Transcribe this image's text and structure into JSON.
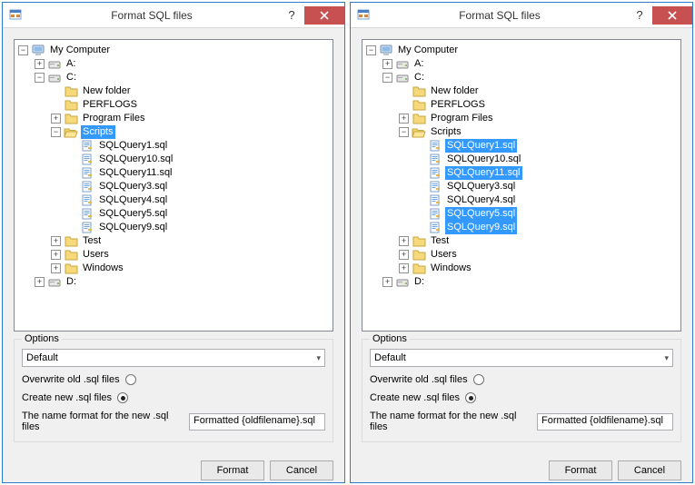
{
  "dialogs": [
    {
      "title": "Format SQL files",
      "tree": [
        {
          "depth": 0,
          "exp": "minus",
          "icon": "computer",
          "label": "My Computer",
          "sel": false
        },
        {
          "depth": 1,
          "exp": "plus",
          "icon": "drive",
          "label": "A:",
          "sel": false
        },
        {
          "depth": 1,
          "exp": "minus",
          "icon": "drive",
          "label": "C:",
          "sel": false
        },
        {
          "depth": 2,
          "exp": "none",
          "icon": "folder",
          "label": "New folder",
          "sel": false
        },
        {
          "depth": 2,
          "exp": "none",
          "icon": "folder",
          "label": "PERFLOGS",
          "sel": false
        },
        {
          "depth": 2,
          "exp": "plus",
          "icon": "folder",
          "label": "Program Files",
          "sel": false
        },
        {
          "depth": 2,
          "exp": "minus",
          "icon": "folder-open",
          "label": "Scripts",
          "sel": true
        },
        {
          "depth": 3,
          "exp": "none",
          "icon": "sql",
          "label": "SQLQuery1.sql",
          "sel": false
        },
        {
          "depth": 3,
          "exp": "none",
          "icon": "sql",
          "label": "SQLQuery10.sql",
          "sel": false
        },
        {
          "depth": 3,
          "exp": "none",
          "icon": "sql",
          "label": "SQLQuery11.sql",
          "sel": false
        },
        {
          "depth": 3,
          "exp": "none",
          "icon": "sql",
          "label": "SQLQuery3.sql",
          "sel": false
        },
        {
          "depth": 3,
          "exp": "none",
          "icon": "sql",
          "label": "SQLQuery4.sql",
          "sel": false
        },
        {
          "depth": 3,
          "exp": "none",
          "icon": "sql",
          "label": "SQLQuery5.sql",
          "sel": false
        },
        {
          "depth": 3,
          "exp": "none",
          "icon": "sql",
          "label": "SQLQuery9.sql",
          "sel": false
        },
        {
          "depth": 2,
          "exp": "plus",
          "icon": "folder",
          "label": "Test",
          "sel": false
        },
        {
          "depth": 2,
          "exp": "plus",
          "icon": "folder",
          "label": "Users",
          "sel": false
        },
        {
          "depth": 2,
          "exp": "plus",
          "icon": "folder",
          "label": "Windows",
          "sel": false
        },
        {
          "depth": 1,
          "exp": "plus",
          "icon": "drive",
          "label": "D:",
          "sel": false
        }
      ],
      "options_label": "Options",
      "combo_value": "Default",
      "overwrite_label": "Overwrite old .sql files",
      "overwrite_checked": false,
      "create_label": "Create new .sql files",
      "create_checked": true,
      "name_format_label": "The name format for the new .sql files",
      "name_format_value": "Formatted {oldfilename}.sql",
      "format_btn": "Format",
      "cancel_btn": "Cancel"
    },
    {
      "title": "Format SQL files",
      "tree": [
        {
          "depth": 0,
          "exp": "minus",
          "icon": "computer",
          "label": "My Computer",
          "sel": false
        },
        {
          "depth": 1,
          "exp": "plus",
          "icon": "drive",
          "label": "A:",
          "sel": false
        },
        {
          "depth": 1,
          "exp": "minus",
          "icon": "drive",
          "label": "C:",
          "sel": false
        },
        {
          "depth": 2,
          "exp": "none",
          "icon": "folder",
          "label": "New folder",
          "sel": false
        },
        {
          "depth": 2,
          "exp": "none",
          "icon": "folder",
          "label": "PERFLOGS",
          "sel": false
        },
        {
          "depth": 2,
          "exp": "plus",
          "icon": "folder",
          "label": "Program Files",
          "sel": false
        },
        {
          "depth": 2,
          "exp": "minus",
          "icon": "folder-open",
          "label": "Scripts",
          "sel": false
        },
        {
          "depth": 3,
          "exp": "none",
          "icon": "sql",
          "label": "SQLQuery1.sql",
          "sel": true
        },
        {
          "depth": 3,
          "exp": "none",
          "icon": "sql",
          "label": "SQLQuery10.sql",
          "sel": false
        },
        {
          "depth": 3,
          "exp": "none",
          "icon": "sql",
          "label": "SQLQuery11.sql",
          "sel": true
        },
        {
          "depth": 3,
          "exp": "none",
          "icon": "sql",
          "label": "SQLQuery3.sql",
          "sel": false
        },
        {
          "depth": 3,
          "exp": "none",
          "icon": "sql",
          "label": "SQLQuery4.sql",
          "sel": false
        },
        {
          "depth": 3,
          "exp": "none",
          "icon": "sql",
          "label": "SQLQuery5.sql",
          "sel": true
        },
        {
          "depth": 3,
          "exp": "none",
          "icon": "sql",
          "label": "SQLQuery9.sql",
          "sel": true
        },
        {
          "depth": 2,
          "exp": "plus",
          "icon": "folder",
          "label": "Test",
          "sel": false
        },
        {
          "depth": 2,
          "exp": "plus",
          "icon": "folder",
          "label": "Users",
          "sel": false
        },
        {
          "depth": 2,
          "exp": "plus",
          "icon": "folder",
          "label": "Windows",
          "sel": false
        },
        {
          "depth": 1,
          "exp": "plus",
          "icon": "drive",
          "label": "D:",
          "sel": false
        }
      ],
      "options_label": "Options",
      "combo_value": "Default",
      "overwrite_label": "Overwrite old .sql files",
      "overwrite_checked": false,
      "create_label": "Create new .sql files",
      "create_checked": true,
      "name_format_label": "The name format for the new .sql files",
      "name_format_value": "Formatted {oldfilename}.sql",
      "format_btn": "Format",
      "cancel_btn": "Cancel"
    }
  ]
}
